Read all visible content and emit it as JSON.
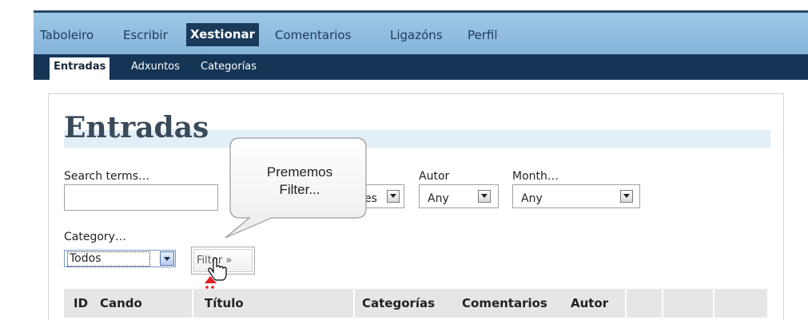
{
  "main_nav": {
    "items": [
      {
        "label": "Taboleiro"
      },
      {
        "label": "Escribir"
      },
      {
        "label": "Xestionar",
        "active": true
      },
      {
        "label": "Comentarios"
      },
      {
        "label": "Ligazóns"
      },
      {
        "label": "Perfil"
      }
    ]
  },
  "sub_nav": {
    "items": [
      {
        "label": "Entradas",
        "active": true
      },
      {
        "label": "Adxuntos"
      },
      {
        "label": "Categorías"
      }
    ]
  },
  "page": {
    "title": "Entradas"
  },
  "filters": {
    "search_label": "Search terms…",
    "search_value": "",
    "status_select_value": "es",
    "author_label": "Autor",
    "author_value": "Any",
    "month_label": "Month…",
    "month_value": "Any",
    "category_label": "Category…",
    "category_value": "Todos",
    "filter_button_label": "Filter »"
  },
  "table": {
    "columns": [
      "ID",
      "Cando",
      "Título",
      "Categorías",
      "Comentarios",
      "Autor"
    ]
  },
  "callout": {
    "text_line1": "Prememos",
    "text_line2": "Filter..."
  },
  "icons": {
    "cursor": "hand-pointer-icon",
    "dropdown": "chevron-down-icon"
  },
  "colors": {
    "main_nav_bg": "#8fbde0",
    "sub_nav_bg": "#143555",
    "accent_dark": "#1a3a5a",
    "cursor_marker": "#e02020"
  }
}
